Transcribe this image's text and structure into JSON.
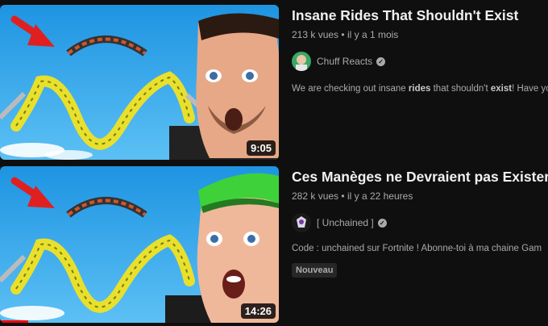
{
  "videos": [
    {
      "title": "Insane Rides That Shouldn't Exist",
      "views": "213 k vues",
      "age": "il y a 1 mois",
      "channel": "Chuff Reacts",
      "verified_icon": "check-circle-icon",
      "description_parts": [
        "We are checking out insane ",
        "rides",
        " that shouldn't ",
        "exist",
        "! Have you"
      ],
      "duration": "9:05",
      "thumbnail_elements": [
        "red-arrow-icon",
        "roller-coaster-loop",
        "man-surprised-face"
      ]
    },
    {
      "title": "Ces Manèges ne Devraient pas Exister...",
      "views": "282 k vues",
      "age": "il y a 22 heures",
      "channel": "[ Unchained ]",
      "verified_icon": "check-circle-icon",
      "description": "Code : unchained sur Fortnite ! Abonne-toi à ma chaine Gam",
      "badge": "Nouveau",
      "duration": "14:26",
      "watch_progress": 0.1,
      "thumbnail_elements": [
        "red-arrow-icon",
        "roller-coaster-loop",
        "man-green-cap-shocked-face"
      ]
    }
  ],
  "separator": "•",
  "colors": {
    "background": "#0f0f0f",
    "title": "#f1f1f1",
    "secondary": "#aaaaaa",
    "sky": "#1f9ae6",
    "track": "#e8e02c",
    "arrow": "#e02020",
    "progress": "#ff0000",
    "cap": "#3fd13a"
  }
}
